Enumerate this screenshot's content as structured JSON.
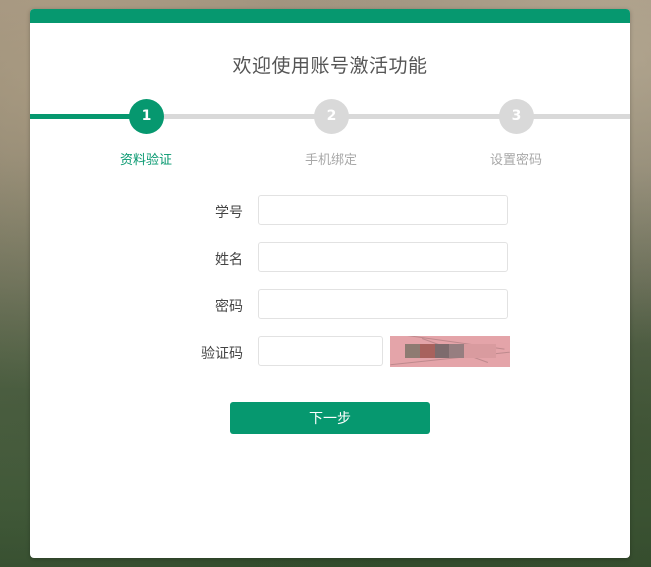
{
  "page": {
    "title": "欢迎使用账号激活功能"
  },
  "colors": {
    "accent": "#06986f",
    "inactive": "#d9d9d9",
    "inactive_text": "#a8a8a8"
  },
  "steps": [
    {
      "number": "1",
      "label": "资料验证",
      "active": true
    },
    {
      "number": "2",
      "label": "手机绑定",
      "active": false
    },
    {
      "number": "3",
      "label": "设置密码",
      "active": false
    }
  ],
  "form": {
    "student_id": {
      "label": "学号",
      "value": ""
    },
    "name": {
      "label": "姓名",
      "value": ""
    },
    "password": {
      "label": "密码",
      "value": ""
    },
    "captcha": {
      "label": "验证码",
      "value": ""
    }
  },
  "buttons": {
    "next_label": "下一步"
  }
}
